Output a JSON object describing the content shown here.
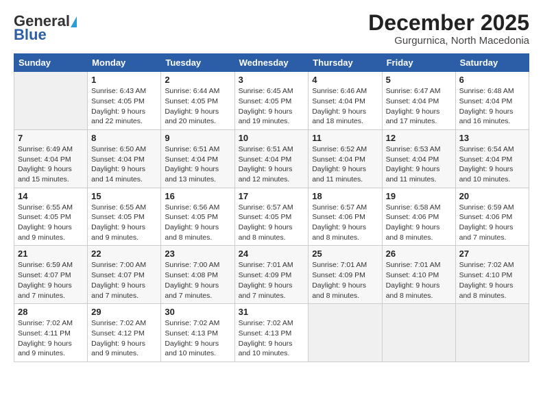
{
  "logo": {
    "general": "General",
    "blue": "Blue"
  },
  "header": {
    "month": "December 2025",
    "location": "Gurgurnica, North Macedonia"
  },
  "weekdays": [
    "Sunday",
    "Monday",
    "Tuesday",
    "Wednesday",
    "Thursday",
    "Friday",
    "Saturday"
  ],
  "weeks": [
    [
      {
        "day": "",
        "detail": ""
      },
      {
        "day": "1",
        "detail": "Sunrise: 6:43 AM\nSunset: 4:05 PM\nDaylight: 9 hours\nand 22 minutes."
      },
      {
        "day": "2",
        "detail": "Sunrise: 6:44 AM\nSunset: 4:05 PM\nDaylight: 9 hours\nand 20 minutes."
      },
      {
        "day": "3",
        "detail": "Sunrise: 6:45 AM\nSunset: 4:05 PM\nDaylight: 9 hours\nand 19 minutes."
      },
      {
        "day": "4",
        "detail": "Sunrise: 6:46 AM\nSunset: 4:04 PM\nDaylight: 9 hours\nand 18 minutes."
      },
      {
        "day": "5",
        "detail": "Sunrise: 6:47 AM\nSunset: 4:04 PM\nDaylight: 9 hours\nand 17 minutes."
      },
      {
        "day": "6",
        "detail": "Sunrise: 6:48 AM\nSunset: 4:04 PM\nDaylight: 9 hours\nand 16 minutes."
      }
    ],
    [
      {
        "day": "7",
        "detail": "Sunrise: 6:49 AM\nSunset: 4:04 PM\nDaylight: 9 hours\nand 15 minutes."
      },
      {
        "day": "8",
        "detail": "Sunrise: 6:50 AM\nSunset: 4:04 PM\nDaylight: 9 hours\nand 14 minutes."
      },
      {
        "day": "9",
        "detail": "Sunrise: 6:51 AM\nSunset: 4:04 PM\nDaylight: 9 hours\nand 13 minutes."
      },
      {
        "day": "10",
        "detail": "Sunrise: 6:51 AM\nSunset: 4:04 PM\nDaylight: 9 hours\nand 12 minutes."
      },
      {
        "day": "11",
        "detail": "Sunrise: 6:52 AM\nSunset: 4:04 PM\nDaylight: 9 hours\nand 11 minutes."
      },
      {
        "day": "12",
        "detail": "Sunrise: 6:53 AM\nSunset: 4:04 PM\nDaylight: 9 hours\nand 11 minutes."
      },
      {
        "day": "13",
        "detail": "Sunrise: 6:54 AM\nSunset: 4:04 PM\nDaylight: 9 hours\nand 10 minutes."
      }
    ],
    [
      {
        "day": "14",
        "detail": "Sunrise: 6:55 AM\nSunset: 4:05 PM\nDaylight: 9 hours\nand 9 minutes."
      },
      {
        "day": "15",
        "detail": "Sunrise: 6:55 AM\nSunset: 4:05 PM\nDaylight: 9 hours\nand 9 minutes."
      },
      {
        "day": "16",
        "detail": "Sunrise: 6:56 AM\nSunset: 4:05 PM\nDaylight: 9 hours\nand 8 minutes."
      },
      {
        "day": "17",
        "detail": "Sunrise: 6:57 AM\nSunset: 4:05 PM\nDaylight: 9 hours\nand 8 minutes."
      },
      {
        "day": "18",
        "detail": "Sunrise: 6:57 AM\nSunset: 4:06 PM\nDaylight: 9 hours\nand 8 minutes."
      },
      {
        "day": "19",
        "detail": "Sunrise: 6:58 AM\nSunset: 4:06 PM\nDaylight: 9 hours\nand 8 minutes."
      },
      {
        "day": "20",
        "detail": "Sunrise: 6:59 AM\nSunset: 4:06 PM\nDaylight: 9 hours\nand 7 minutes."
      }
    ],
    [
      {
        "day": "21",
        "detail": "Sunrise: 6:59 AM\nSunset: 4:07 PM\nDaylight: 9 hours\nand 7 minutes."
      },
      {
        "day": "22",
        "detail": "Sunrise: 7:00 AM\nSunset: 4:07 PM\nDaylight: 9 hours\nand 7 minutes."
      },
      {
        "day": "23",
        "detail": "Sunrise: 7:00 AM\nSunset: 4:08 PM\nDaylight: 9 hours\nand 7 minutes."
      },
      {
        "day": "24",
        "detail": "Sunrise: 7:01 AM\nSunset: 4:09 PM\nDaylight: 9 hours\nand 7 minutes."
      },
      {
        "day": "25",
        "detail": "Sunrise: 7:01 AM\nSunset: 4:09 PM\nDaylight: 9 hours\nand 8 minutes."
      },
      {
        "day": "26",
        "detail": "Sunrise: 7:01 AM\nSunset: 4:10 PM\nDaylight: 9 hours\nand 8 minutes."
      },
      {
        "day": "27",
        "detail": "Sunrise: 7:02 AM\nSunset: 4:10 PM\nDaylight: 9 hours\nand 8 minutes."
      }
    ],
    [
      {
        "day": "28",
        "detail": "Sunrise: 7:02 AM\nSunset: 4:11 PM\nDaylight: 9 hours\nand 9 minutes."
      },
      {
        "day": "29",
        "detail": "Sunrise: 7:02 AM\nSunset: 4:12 PM\nDaylight: 9 hours\nand 9 minutes."
      },
      {
        "day": "30",
        "detail": "Sunrise: 7:02 AM\nSunset: 4:13 PM\nDaylight: 9 hours\nand 10 minutes."
      },
      {
        "day": "31",
        "detail": "Sunrise: 7:02 AM\nSunset: 4:13 PM\nDaylight: 9 hours\nand 10 minutes."
      },
      {
        "day": "",
        "detail": ""
      },
      {
        "day": "",
        "detail": ""
      },
      {
        "day": "",
        "detail": ""
      }
    ]
  ]
}
